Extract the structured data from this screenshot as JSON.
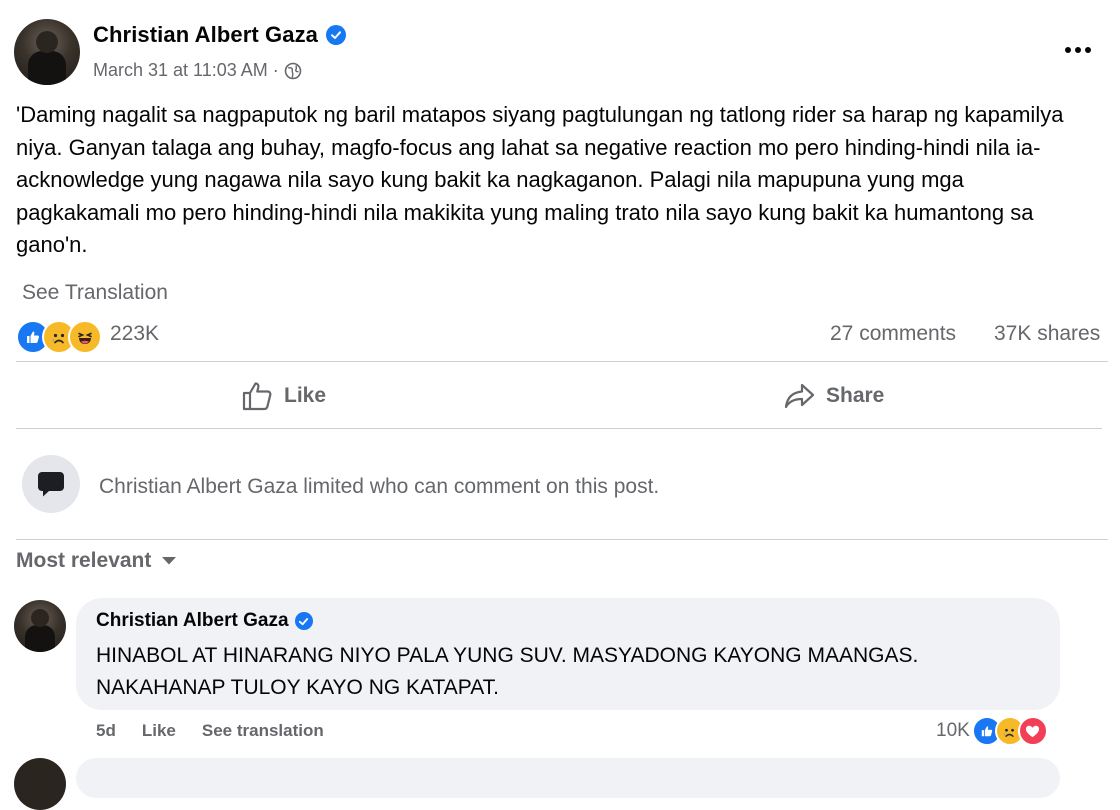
{
  "post": {
    "author": "Christian Albert Gaza",
    "timestamp": "March 31 at 11:03 AM",
    "meta_separator": "·",
    "privacy_icon": "globe-icon",
    "text": "'Daming nagalit sa nagpaputok ng baril matapos siyang pagtulungan ng tatlong rider sa harap ng kapamilya niya. Ganyan talaga ang buhay, magfo-focus ang lahat sa negative reaction mo pero hinding-hindi nila ia-acknowledge yung nagawa nila sayo kung bakit ka nagkaganon. Palagi nila mapupuna yung mga pagkakamali mo pero hinding-hindi nila makikita yung maling trato nila sayo kung bakit ka humantong sa gano'n.",
    "see_translation": "See Translation"
  },
  "stats": {
    "reactions": "223K",
    "reaction_icons": [
      "like-icon",
      "sad-icon",
      "haha-icon"
    ],
    "comments": "27 comments",
    "shares": "37K shares"
  },
  "actions": {
    "like_label": "Like",
    "share_label": "Share"
  },
  "notice": {
    "text": "Christian Albert Gaza limited who can comment on this post."
  },
  "sort": {
    "label": "Most relevant"
  },
  "comments": [
    {
      "author": "Christian Albert Gaza",
      "text_line1": "HINABOL AT HINARANG NIYO PALA YUNG SUV. MASYADONG KAYONG MAANGAS.",
      "text_line2": "NAKAHANAP TULOY KAYO NG KATAPAT.",
      "age": "5d",
      "like_label": "Like",
      "translate_label": "See translation",
      "reactions": "10K",
      "reaction_icons": [
        "like-icon",
        "sad-icon",
        "love-icon"
      ]
    }
  ],
  "colors": {
    "accent": "#1877f2",
    "secondary_text": "#65676b",
    "bubble_bg": "#f0f2f5"
  }
}
